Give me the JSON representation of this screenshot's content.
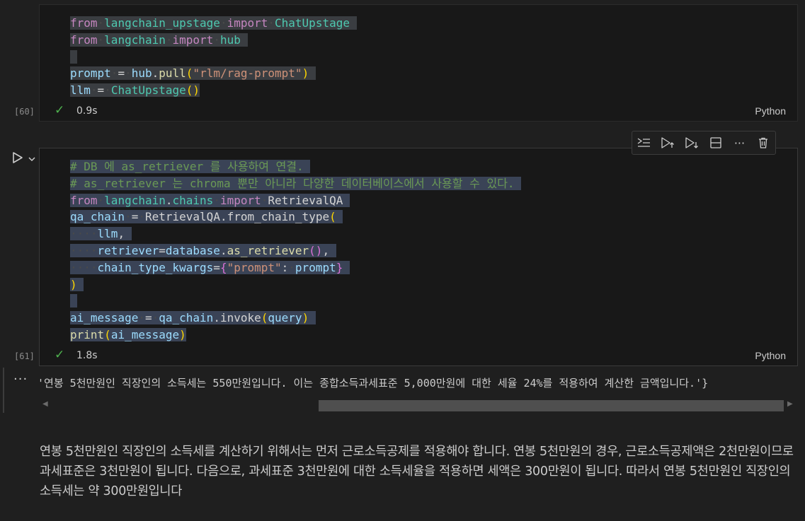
{
  "cell1": {
    "exec_count": "[60]",
    "status_check": "✓",
    "time": "0.9s",
    "language": "Python"
  },
  "cell2": {
    "exec_count": "[61]",
    "status_check": "✓",
    "time": "1.8s",
    "language": "Python"
  },
  "toolbar": {
    "icons": [
      "execute-above-icon",
      "run-above-icon",
      "run-below-icon",
      "split-cell-icon",
      "more-icon",
      "delete-icon"
    ],
    "more_label": "···"
  },
  "output": {
    "dots": "···",
    "text": "'연봉 5천만원인 직장인의 소득세는 550만원입니다. 이는 종합소득과세표준 5,000만원에 대한 세율 24%를 적용하여 계산한 금액입니다.'}"
  },
  "markdown": {
    "paragraph": "연봉 5천만원인 직장인의 소득세를 계산하기 위해서는 먼저 근로소득공제를 적용해야 합니다. 연봉 5천만원의 경우, 근로소득공제액은 2천만원이므로 과세표준은 3천만원이 됩니다. 다음으로, 과세표준 3천만원에 대한 소득세율을 적용하면 세액은 300만원이 됩니다. 따라서 연봉 5천만원인 직장인의 소득세는 약 300만원입니다"
  },
  "code": {
    "t_from": "from",
    "t_import": "import",
    "t_mod1": "langchain_upstage",
    "t_cls1": "ChatUpstage",
    "t_mod2": "langchain",
    "t_hub": "hub",
    "t_prompt": "prompt",
    "t_eq": "=",
    "t_pull": "pull",
    "t_pull_arg": "\"rlm/rag-prompt\"",
    "t_llm": "llm",
    "t_cm1": "# DB 에 as_retriever 를 사용하여 연결.",
    "t_cm2": "# as_retriever 는 chroma 뿐만 아니라 다양한 데이터베이스에서 사용할 수 있다.",
    "t_chains": "chains",
    "t_rqa": "RetrievalQA",
    "t_qa_chain": "qa_chain",
    "t_from_chain_type": "from_chain_type",
    "t_retriever": "retriever",
    "t_database": "database",
    "t_as_retriever": "as_retriever",
    "t_kwargs": "chain_type_kwargs",
    "t_prompt_str": "\"prompt\"",
    "t_ai_message": "ai_message",
    "t_invoke": "invoke",
    "t_query": "query",
    "t_print": "print"
  }
}
